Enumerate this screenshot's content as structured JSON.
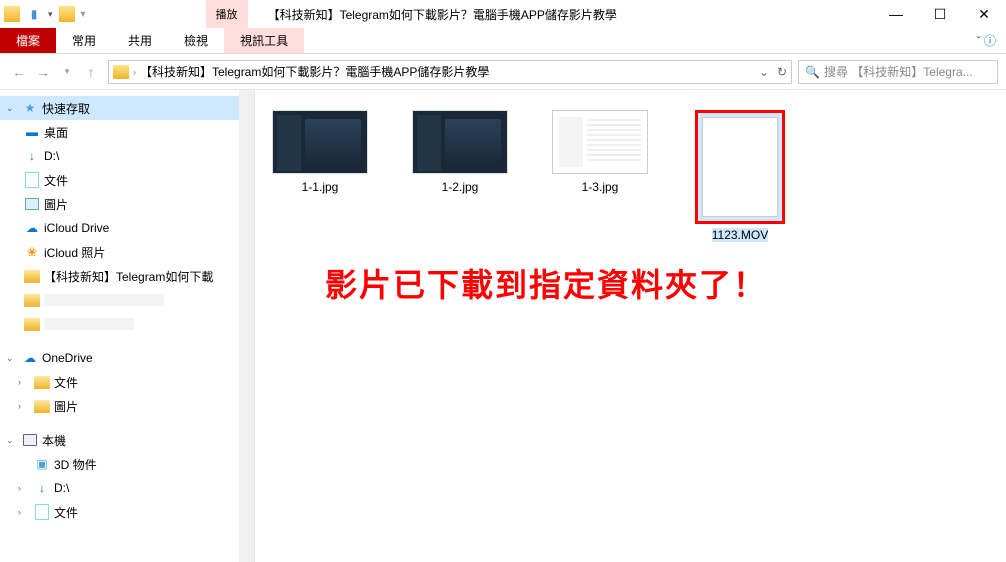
{
  "titlebar": {
    "play_tab": "播放",
    "window_title": "【科技新知】Telegram如何下載影片？電腦手機APP儲存影片教學"
  },
  "ribbon": {
    "file": "檔案",
    "home": "常用",
    "share": "共用",
    "view": "檢視",
    "video_tools": "視訊工具"
  },
  "nav": {
    "breadcrumb": "【科技新知】Telegram如何下載影片？電腦手機APP儲存影片教學",
    "search_placeholder": "搜尋 【科技新知】Telegra..."
  },
  "sidebar": {
    "quick_access": "快速存取",
    "desktop": "桌面",
    "d_drive": "D:\\",
    "documents": "文件",
    "pictures": "圖片",
    "icloud_drive": "iCloud Drive",
    "icloud_photos": "iCloud 照片",
    "telegram_folder": "【科技新知】Telegram如何下載",
    "onedrive": "OneDrive",
    "od_documents": "文件",
    "od_pictures": "圖片",
    "this_pc": "本機",
    "objects_3d": "3D 物件",
    "pc_d_drive": "D:\\",
    "pc_documents": "文件"
  },
  "files": [
    {
      "name": "1-1.jpg",
      "type": "image-dark"
    },
    {
      "name": "1-2.jpg",
      "type": "image-dark"
    },
    {
      "name": "1-3.jpg",
      "type": "image-light"
    },
    {
      "name": "1123.MOV",
      "type": "video",
      "selected": true
    }
  ],
  "annotation": "影片已下載到指定資料夾了！"
}
